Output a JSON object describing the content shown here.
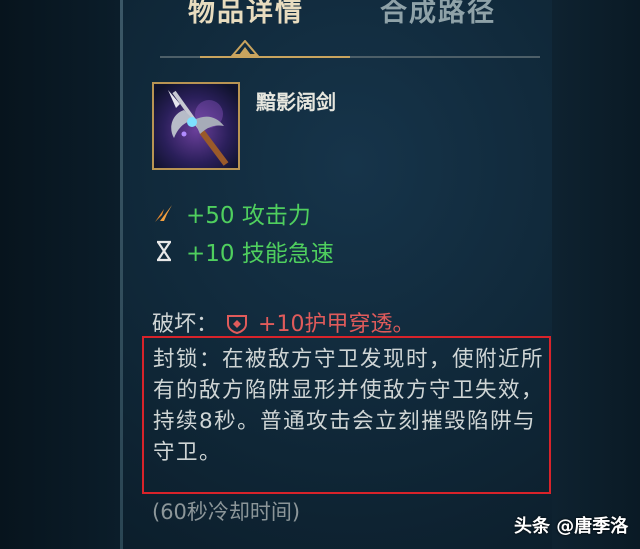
{
  "tabs": {
    "details": "物品详情",
    "recipe": "合成路径"
  },
  "item": {
    "name": "黯影阔剑",
    "icon": "lethality-sword-icon"
  },
  "stats": [
    {
      "icon": "attack-damage-icon",
      "text": "+50 攻击力",
      "color": "#4fcf5e"
    },
    {
      "icon": "ability-haste-icon",
      "text": "+10 技能急速",
      "color": "#4fcf5e"
    }
  ],
  "passive_break": {
    "label": "破坏：",
    "icon": "armor-penetration-icon",
    "value": "+10护甲穿透。",
    "color": "#e05b5b"
  },
  "passive_seal": {
    "text": "封锁：在被敌方守卫发现时，使附近所有的敌方陷阱显形并使敌方守卫失效，持续8秒。普通攻击会立刻摧毁陷阱与守卫。"
  },
  "cooldown": "(60秒冷却时间)",
  "watermark": "头条 @唐季洛",
  "colors": {
    "tab_active": "#e8dcbf",
    "gold_accent": "#c9a45e",
    "highlight_border": "#d8232a"
  }
}
